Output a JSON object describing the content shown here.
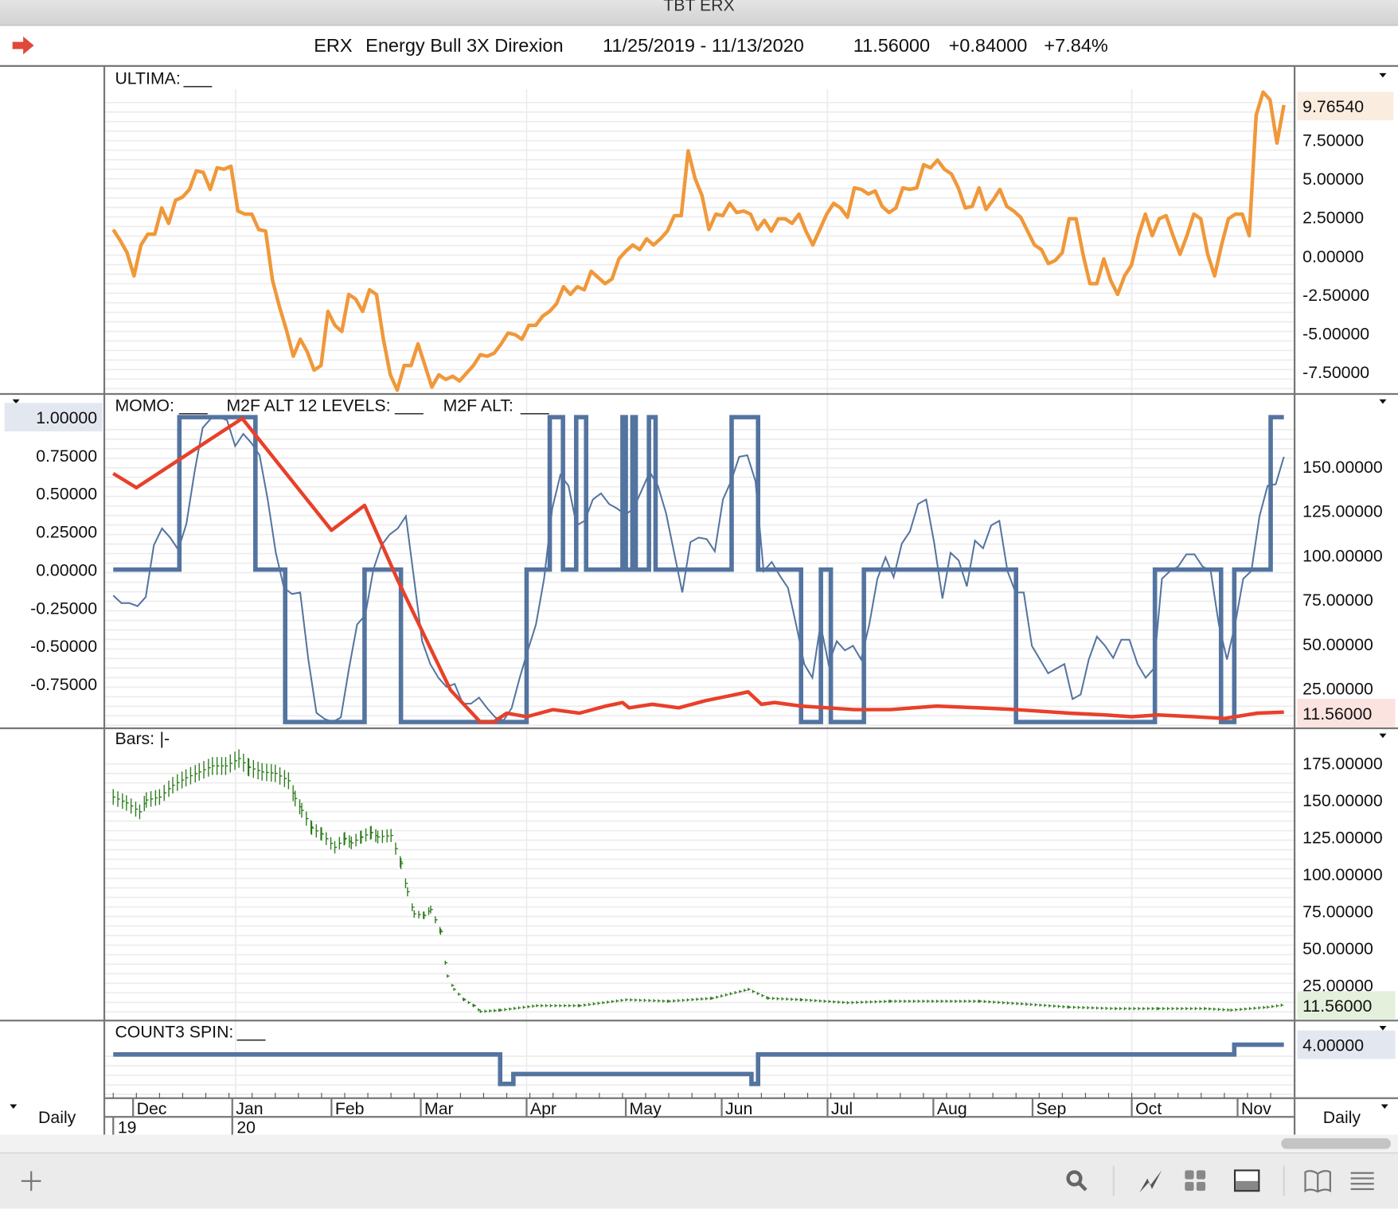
{
  "window": {
    "title": "TBT ERX"
  },
  "header": {
    "symbol": "ERX",
    "name": "Energy Bull 3X Direxion",
    "date_range": "11/25/2019 - 11/13/2020",
    "last": "11.56000",
    "change": "+0.84000",
    "change_pct": "+7.84%"
  },
  "colors": {
    "ultima": "#f0983a",
    "momo": "#e8402a",
    "m2f": "#5474a0",
    "bars": "#2a7a1a",
    "count3": "#5474a0"
  },
  "timeframe": {
    "left": "Daily",
    "right": "Daily"
  },
  "toolbar": {
    "icons": [
      "plus-icon",
      "search-icon",
      "chart-line-icon",
      "grid-icon",
      "layout-icon",
      "book-icon",
      "menu-icon"
    ]
  },
  "chart_data": [
    {
      "type": "line",
      "pane": "ULTIMA",
      "title": "ULTIMA:",
      "legend_marker": "___",
      "x_start": "11/25/2019",
      "x_end": "11/13/2020",
      "yticks": [
        7.5,
        5.0,
        2.5,
        0.0,
        -2.5,
        -5.0,
        -7.5
      ],
      "ytick_labels": [
        "7.50000",
        "5.00000",
        "2.50000",
        "0.00000",
        "-2.50000",
        "-5.00000",
        "-7.50000"
      ],
      "last_value_label": "9.76540",
      "series": [
        {
          "name": "ULTIMA",
          "values": [
            1.7,
            1.0,
            0.2,
            -1.3,
            0.7,
            1.4,
            1.4,
            3.1,
            2.1,
            3.6,
            3.8,
            4.3,
            5.5,
            5.4,
            4.3,
            5.7,
            5.6,
            5.8,
            2.9,
            2.7,
            2.7,
            1.7,
            1.6,
            -1.6,
            -3.3,
            -4.8,
            -6.5,
            -5.4,
            -6.2,
            -7.4,
            -7.1,
            -3.6,
            -4.5,
            -4.9,
            -2.5,
            -2.8,
            -3.6,
            -2.2,
            -2.5,
            -5.4,
            -7.7,
            -8.7,
            -7.1,
            -7.1,
            -5.7,
            -7.1,
            -8.5,
            -7.7,
            -8.0,
            -7.8,
            -8.1,
            -7.6,
            -7.1,
            -6.4,
            -6.5,
            -6.3,
            -5.7,
            -5.0,
            -5.1,
            -5.4,
            -4.5,
            -4.5,
            -3.9,
            -3.6,
            -3.1,
            -2.0,
            -2.5,
            -2.0,
            -2.2,
            -1.0,
            -1.4,
            -1.8,
            -1.5,
            -0.2,
            0.3,
            0.7,
            0.4,
            1.1,
            0.7,
            1.1,
            1.6,
            2.6,
            2.6,
            6.8,
            5.0,
            3.9,
            1.7,
            2.7,
            2.6,
            3.4,
            2.8,
            2.9,
            2.7,
            1.7,
            2.3,
            1.6,
            2.4,
            2.4,
            2.1,
            2.7,
            1.6,
            0.7,
            1.7,
            2.7,
            3.4,
            3.1,
            2.5,
            4.4,
            4.3,
            4.0,
            4.2,
            3.2,
            2.8,
            3.1,
            4.4,
            4.3,
            4.4,
            5.9,
            5.7,
            6.2,
            5.6,
            5.3,
            4.4,
            3.1,
            3.2,
            4.4,
            3.0,
            3.6,
            4.3,
            3.2,
            2.9,
            2.5,
            1.6,
            0.7,
            0.4,
            -0.5,
            -0.3,
            0.2,
            2.4,
            2.4,
            0.1,
            -1.8,
            -1.8,
            -0.2,
            -1.6,
            -2.5,
            -1.3,
            -0.6,
            1.3,
            2.7,
            1.3,
            2.4,
            2.6,
            1.3,
            0.1,
            1.3,
            2.7,
            2.4,
            0.1,
            -1.3,
            0.7,
            2.4,
            2.7,
            2.7,
            1.3,
            9.1,
            10.6,
            10.1,
            7.3,
            9.7654
          ]
        }
      ]
    },
    {
      "type": "line",
      "pane": "MOMO / M2F",
      "legend": [
        {
          "label": "MOMO:",
          "marker": "___"
        },
        {
          "label": "M2F ALT 12 LEVELS:",
          "marker": "___"
        },
        {
          "label": "M2F ALT:",
          "marker": "___"
        }
      ],
      "left_yticks": [
        0.75,
        0.5,
        0.25,
        0.0,
        -0.25,
        -0.5,
        -0.75
      ],
      "left_ytick_labels": [
        "0.75000",
        "0.50000",
        "0.25000",
        "0.00000",
        "-0.25000",
        "-0.50000",
        "-0.75000"
      ],
      "left_highlight_label": "1.00000",
      "right_yticks": [
        150,
        125,
        100,
        75,
        50,
        25
      ],
      "right_ytick_labels": [
        "150.00000",
        "125.00000",
        "100.00000",
        "75.00000",
        "50.00000",
        "25.00000"
      ],
      "right_highlight_label": "11.56000",
      "momo": {
        "axis": "right",
        "points_day_value": [
          [
            0,
            146
          ],
          [
            7,
            138
          ],
          [
            39,
            177
          ],
          [
            66,
            114
          ],
          [
            76,
            128
          ],
          [
            86,
            86
          ],
          [
            102,
            24
          ],
          [
            106,
            16
          ],
          [
            111,
            6
          ],
          [
            115,
            6
          ],
          [
            119,
            11
          ],
          [
            125,
            9
          ],
          [
            133,
            13
          ],
          [
            141,
            11
          ],
          [
            149,
            15
          ],
          [
            154,
            17
          ],
          [
            156,
            14
          ],
          [
            163,
            16
          ],
          [
            171,
            14
          ],
          [
            179,
            18
          ],
          [
            187,
            21
          ],
          [
            192,
            23
          ],
          [
            196,
            16
          ],
          [
            200,
            17
          ],
          [
            208,
            15
          ],
          [
            216,
            14
          ],
          [
            224,
            13
          ],
          [
            235,
            13
          ],
          [
            249,
            15
          ],
          [
            262,
            14
          ],
          [
            273,
            13
          ],
          [
            289,
            11
          ],
          [
            300,
            10
          ],
          [
            308,
            9
          ],
          [
            316,
            10
          ],
          [
            327,
            9
          ],
          [
            336,
            8
          ],
          [
            346,
            11
          ],
          [
            354,
            11.56
          ]
        ]
      },
      "m2f_alt_12_levels": {
        "axis": "left",
        "steps_day_level": [
          [
            0,
            0
          ],
          [
            20,
            1
          ],
          [
            43,
            0
          ],
          [
            52,
            -1
          ],
          [
            76,
            0
          ],
          [
            87,
            -1
          ],
          [
            125,
            0
          ],
          [
            132,
            1
          ],
          [
            136,
            0
          ],
          [
            140,
            1
          ],
          [
            143,
            0
          ],
          [
            154,
            1
          ],
          [
            155,
            0
          ],
          [
            157,
            1
          ],
          [
            158,
            0
          ],
          [
            162,
            1
          ],
          [
            164,
            0
          ],
          [
            187,
            1
          ],
          [
            195,
            0
          ],
          [
            208,
            -1
          ],
          [
            214,
            0
          ],
          [
            217,
            -1
          ],
          [
            227,
            0
          ],
          [
            273,
            -1
          ],
          [
            315,
            0
          ],
          [
            335,
            -1
          ],
          [
            339,
            0
          ],
          [
            350,
            1
          ]
        ],
        "end_day": 354
      },
      "m2f_alt": {
        "axis": "left",
        "values": [
          -0.17,
          -0.22,
          -0.22,
          -0.24,
          -0.18,
          0.16,
          0.27,
          0.21,
          0.13,
          0.3,
          0.64,
          0.93,
          0.99,
          1.0,
          0.98,
          0.81,
          0.89,
          0.83,
          0.75,
          0.46,
          0.11,
          -0.12,
          -0.16,
          -0.15,
          -0.59,
          -0.94,
          -0.98,
          -1.0,
          -0.97,
          -0.65,
          -0.36,
          -0.3,
          0.0,
          0.16,
          0.23,
          0.27,
          0.35,
          -0.06,
          -0.47,
          -0.62,
          -0.71,
          -0.77,
          -0.75,
          -0.88,
          -0.88,
          -0.84,
          -0.91,
          -0.97,
          -0.99,
          -0.91,
          -0.71,
          -0.53,
          -0.36,
          -0.06,
          0.4,
          0.62,
          0.55,
          0.29,
          0.32,
          0.46,
          0.5,
          0.43,
          0.4,
          0.36,
          0.4,
          0.52,
          0.64,
          0.55,
          0.37,
          0.11,
          -0.15,
          0.18,
          0.21,
          0.2,
          0.12,
          0.46,
          0.58,
          0.74,
          0.75,
          0.58,
          -0.01,
          0.05,
          -0.04,
          -0.12,
          -0.36,
          -0.62,
          -0.71,
          -0.36,
          -0.62,
          -0.47,
          -0.53,
          -0.5,
          -0.59,
          -0.36,
          -0.06,
          0.08,
          -0.05,
          0.17,
          0.25,
          0.43,
          0.46,
          0.17,
          -0.19,
          0.11,
          0.06,
          -0.11,
          0.19,
          0.14,
          0.29,
          0.32,
          -0.01,
          -0.15,
          -0.15,
          -0.5,
          -0.59,
          -0.68,
          -0.65,
          -0.62,
          -0.85,
          -0.82,
          -0.59,
          -0.44,
          -0.5,
          -0.58,
          -0.46,
          -0.46,
          -0.62,
          -0.71,
          -0.65,
          -0.06,
          -0.01,
          0.02,
          0.1,
          0.1,
          0.02,
          -0.01,
          -0.36,
          -0.59,
          -0.36,
          -0.06,
          -0.01,
          0.35,
          0.55,
          0.56,
          0.74
        ]
      }
    },
    {
      "type": "bar",
      "pane": "Bars",
      "title": "Bars:",
      "legend_marker": "|-",
      "yticks": [
        175,
        150,
        125,
        100,
        75,
        50,
        25
      ],
      "ytick_labels": [
        "175.00000",
        "150.00000",
        "125.00000",
        "100.00000",
        "75.00000",
        "50.00000",
        "25.00000"
      ],
      "last_value_label": "11.56000",
      "closes_day_value": [
        [
          0,
          152
        ],
        [
          4,
          148
        ],
        [
          8,
          142
        ],
        [
          10,
          150
        ],
        [
          14,
          152
        ],
        [
          18,
          160
        ],
        [
          22,
          165
        ],
        [
          26,
          169
        ],
        [
          30,
          173
        ],
        [
          34,
          173
        ],
        [
          38,
          178
        ],
        [
          41,
          172
        ],
        [
          45,
          169
        ],
        [
          49,
          168
        ],
        [
          53,
          163
        ],
        [
          55,
          151
        ],
        [
          57,
          143
        ],
        [
          60,
          131
        ],
        [
          63,
          127
        ],
        [
          67,
          118
        ],
        [
          70,
          124
        ],
        [
          72,
          121
        ],
        [
          75,
          125
        ],
        [
          78,
          128
        ],
        [
          80,
          125
        ],
        [
          84,
          126
        ],
        [
          87,
          107
        ],
        [
          89,
          88
        ],
        [
          91,
          73
        ],
        [
          94,
          72
        ],
        [
          96,
          76
        ],
        [
          99,
          61
        ],
        [
          101,
          31
        ],
        [
          103,
          22
        ],
        [
          106,
          15
        ],
        [
          109,
          11
        ],
        [
          111,
          7
        ],
        [
          117,
          8
        ],
        [
          128,
          11
        ],
        [
          141,
          11
        ],
        [
          155,
          15
        ],
        [
          168,
          14
        ],
        [
          181,
          16
        ],
        [
          192,
          22
        ],
        [
          198,
          16
        ],
        [
          208,
          15
        ],
        [
          222,
          13
        ],
        [
          235,
          14
        ],
        [
          249,
          14
        ],
        [
          262,
          14
        ],
        [
          276,
          12
        ],
        [
          289,
          10
        ],
        [
          303,
          9
        ],
        [
          316,
          9
        ],
        [
          330,
          9
        ],
        [
          338,
          8
        ],
        [
          349,
          10
        ],
        [
          354,
          11.56
        ]
      ]
    },
    {
      "type": "line",
      "pane": "COUNT3 SPIN",
      "title": "COUNT3 SPIN:",
      "legend_marker": "___",
      "last_value_label": "4.00000",
      "steps_day_level": [
        [
          0,
          3
        ],
        [
          117,
          0
        ],
        [
          121,
          1
        ],
        [
          193,
          0
        ],
        [
          195,
          3
        ],
        [
          339,
          4
        ]
      ],
      "end_day": 354
    }
  ],
  "x_axis": {
    "months": [
      {
        "label": "Dec",
        "day": 6
      },
      {
        "label": "Jan",
        "day": 36
      },
      {
        "label": "Feb",
        "day": 66
      },
      {
        "label": "Mar",
        "day": 93
      },
      {
        "label": "Apr",
        "day": 125
      },
      {
        "label": "May",
        "day": 155
      },
      {
        "label": "Jun",
        "day": 184
      },
      {
        "label": "Jul",
        "day": 216
      },
      {
        "label": "Aug",
        "day": 248
      },
      {
        "label": "Sep",
        "day": 278
      },
      {
        "label": "Oct",
        "day": 308
      },
      {
        "label": "Nov",
        "day": 340
      }
    ],
    "years": [
      {
        "label": "19",
        "day": 0
      },
      {
        "label": "20",
        "day": 36
      }
    ]
  }
}
